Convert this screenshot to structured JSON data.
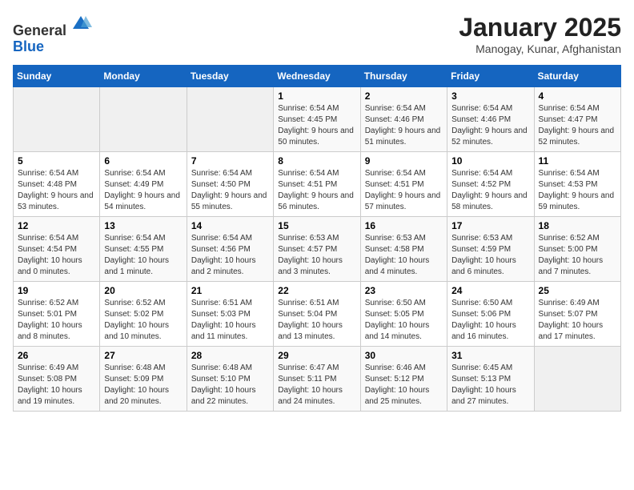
{
  "header": {
    "logo_general": "General",
    "logo_blue": "Blue",
    "title": "January 2025",
    "subtitle": "Manogay, Kunar, Afghanistan"
  },
  "days_of_week": [
    "Sunday",
    "Monday",
    "Tuesday",
    "Wednesday",
    "Thursday",
    "Friday",
    "Saturday"
  ],
  "weeks": [
    [
      {
        "num": "",
        "sunrise": "",
        "sunset": "",
        "daylight": ""
      },
      {
        "num": "",
        "sunrise": "",
        "sunset": "",
        "daylight": ""
      },
      {
        "num": "",
        "sunrise": "",
        "sunset": "",
        "daylight": ""
      },
      {
        "num": "1",
        "sunrise": "Sunrise: 6:54 AM",
        "sunset": "Sunset: 4:45 PM",
        "daylight": "Daylight: 9 hours and 50 minutes."
      },
      {
        "num": "2",
        "sunrise": "Sunrise: 6:54 AM",
        "sunset": "Sunset: 4:46 PM",
        "daylight": "Daylight: 9 hours and 51 minutes."
      },
      {
        "num": "3",
        "sunrise": "Sunrise: 6:54 AM",
        "sunset": "Sunset: 4:46 PM",
        "daylight": "Daylight: 9 hours and 52 minutes."
      },
      {
        "num": "4",
        "sunrise": "Sunrise: 6:54 AM",
        "sunset": "Sunset: 4:47 PM",
        "daylight": "Daylight: 9 hours and 52 minutes."
      }
    ],
    [
      {
        "num": "5",
        "sunrise": "Sunrise: 6:54 AM",
        "sunset": "Sunset: 4:48 PM",
        "daylight": "Daylight: 9 hours and 53 minutes."
      },
      {
        "num": "6",
        "sunrise": "Sunrise: 6:54 AM",
        "sunset": "Sunset: 4:49 PM",
        "daylight": "Daylight: 9 hours and 54 minutes."
      },
      {
        "num": "7",
        "sunrise": "Sunrise: 6:54 AM",
        "sunset": "Sunset: 4:50 PM",
        "daylight": "Daylight: 9 hours and 55 minutes."
      },
      {
        "num": "8",
        "sunrise": "Sunrise: 6:54 AM",
        "sunset": "Sunset: 4:51 PM",
        "daylight": "Daylight: 9 hours and 56 minutes."
      },
      {
        "num": "9",
        "sunrise": "Sunrise: 6:54 AM",
        "sunset": "Sunset: 4:51 PM",
        "daylight": "Daylight: 9 hours and 57 minutes."
      },
      {
        "num": "10",
        "sunrise": "Sunrise: 6:54 AM",
        "sunset": "Sunset: 4:52 PM",
        "daylight": "Daylight: 9 hours and 58 minutes."
      },
      {
        "num": "11",
        "sunrise": "Sunrise: 6:54 AM",
        "sunset": "Sunset: 4:53 PM",
        "daylight": "Daylight: 9 hours and 59 minutes."
      }
    ],
    [
      {
        "num": "12",
        "sunrise": "Sunrise: 6:54 AM",
        "sunset": "Sunset: 4:54 PM",
        "daylight": "Daylight: 10 hours and 0 minutes."
      },
      {
        "num": "13",
        "sunrise": "Sunrise: 6:54 AM",
        "sunset": "Sunset: 4:55 PM",
        "daylight": "Daylight: 10 hours and 1 minute."
      },
      {
        "num": "14",
        "sunrise": "Sunrise: 6:54 AM",
        "sunset": "Sunset: 4:56 PM",
        "daylight": "Daylight: 10 hours and 2 minutes."
      },
      {
        "num": "15",
        "sunrise": "Sunrise: 6:53 AM",
        "sunset": "Sunset: 4:57 PM",
        "daylight": "Daylight: 10 hours and 3 minutes."
      },
      {
        "num": "16",
        "sunrise": "Sunrise: 6:53 AM",
        "sunset": "Sunset: 4:58 PM",
        "daylight": "Daylight: 10 hours and 4 minutes."
      },
      {
        "num": "17",
        "sunrise": "Sunrise: 6:53 AM",
        "sunset": "Sunset: 4:59 PM",
        "daylight": "Daylight: 10 hours and 6 minutes."
      },
      {
        "num": "18",
        "sunrise": "Sunrise: 6:52 AM",
        "sunset": "Sunset: 5:00 PM",
        "daylight": "Daylight: 10 hours and 7 minutes."
      }
    ],
    [
      {
        "num": "19",
        "sunrise": "Sunrise: 6:52 AM",
        "sunset": "Sunset: 5:01 PM",
        "daylight": "Daylight: 10 hours and 8 minutes."
      },
      {
        "num": "20",
        "sunrise": "Sunrise: 6:52 AM",
        "sunset": "Sunset: 5:02 PM",
        "daylight": "Daylight: 10 hours and 10 minutes."
      },
      {
        "num": "21",
        "sunrise": "Sunrise: 6:51 AM",
        "sunset": "Sunset: 5:03 PM",
        "daylight": "Daylight: 10 hours and 11 minutes."
      },
      {
        "num": "22",
        "sunrise": "Sunrise: 6:51 AM",
        "sunset": "Sunset: 5:04 PM",
        "daylight": "Daylight: 10 hours and 13 minutes."
      },
      {
        "num": "23",
        "sunrise": "Sunrise: 6:50 AM",
        "sunset": "Sunset: 5:05 PM",
        "daylight": "Daylight: 10 hours and 14 minutes."
      },
      {
        "num": "24",
        "sunrise": "Sunrise: 6:50 AM",
        "sunset": "Sunset: 5:06 PM",
        "daylight": "Daylight: 10 hours and 16 minutes."
      },
      {
        "num": "25",
        "sunrise": "Sunrise: 6:49 AM",
        "sunset": "Sunset: 5:07 PM",
        "daylight": "Daylight: 10 hours and 17 minutes."
      }
    ],
    [
      {
        "num": "26",
        "sunrise": "Sunrise: 6:49 AM",
        "sunset": "Sunset: 5:08 PM",
        "daylight": "Daylight: 10 hours and 19 minutes."
      },
      {
        "num": "27",
        "sunrise": "Sunrise: 6:48 AM",
        "sunset": "Sunset: 5:09 PM",
        "daylight": "Daylight: 10 hours and 20 minutes."
      },
      {
        "num": "28",
        "sunrise": "Sunrise: 6:48 AM",
        "sunset": "Sunset: 5:10 PM",
        "daylight": "Daylight: 10 hours and 22 minutes."
      },
      {
        "num": "29",
        "sunrise": "Sunrise: 6:47 AM",
        "sunset": "Sunset: 5:11 PM",
        "daylight": "Daylight: 10 hours and 24 minutes."
      },
      {
        "num": "30",
        "sunrise": "Sunrise: 6:46 AM",
        "sunset": "Sunset: 5:12 PM",
        "daylight": "Daylight: 10 hours and 25 minutes."
      },
      {
        "num": "31",
        "sunrise": "Sunrise: 6:45 AM",
        "sunset": "Sunset: 5:13 PM",
        "daylight": "Daylight: 10 hours and 27 minutes."
      },
      {
        "num": "",
        "sunrise": "",
        "sunset": "",
        "daylight": ""
      }
    ]
  ]
}
